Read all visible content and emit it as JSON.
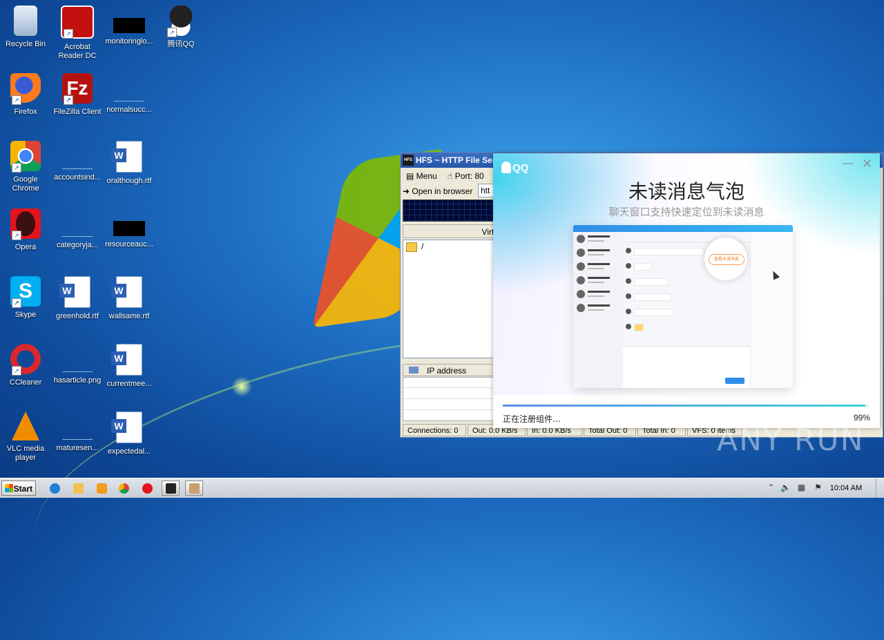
{
  "desktop": {
    "icons": [
      {
        "label": "Recycle Bin",
        "icon": "recycle-bin-icon"
      },
      {
        "label": "Acrobat Reader DC",
        "icon": "acrobat-icon"
      },
      {
        "label": "monitoringlo...",
        "icon": "file-icon"
      },
      {
        "label": "腾讯QQ",
        "icon": "qq-icon"
      },
      {
        "label": "Firefox",
        "icon": "firefox-icon"
      },
      {
        "label": "FileZilla Client",
        "icon": "filezilla-icon"
      },
      {
        "label": "normalsucc...",
        "icon": "file-icon"
      },
      {
        "label": "Google Chrome",
        "icon": "chrome-icon"
      },
      {
        "label": "accountsind...",
        "icon": "file-icon"
      },
      {
        "label": "oralthough.rtf",
        "icon": "word-doc-icon"
      },
      {
        "label": "Opera",
        "icon": "opera-icon"
      },
      {
        "label": "categoryja...",
        "icon": "file-icon"
      },
      {
        "label": "resourceauc...",
        "icon": "file-icon"
      },
      {
        "label": "Skype",
        "icon": "skype-icon"
      },
      {
        "label": "greenhold.rtf",
        "icon": "word-doc-icon"
      },
      {
        "label": "wallsame.rtf",
        "icon": "word-doc-icon"
      },
      {
        "label": "CCleaner",
        "icon": "ccleaner-icon"
      },
      {
        "label": "hasarticle.png",
        "icon": "file-icon"
      },
      {
        "label": "currentmee...",
        "icon": "word-doc-icon"
      },
      {
        "label": "VLC media player",
        "icon": "vlc-icon"
      },
      {
        "label": "maturesen...",
        "icon": "file-icon"
      },
      {
        "label": "expectedal...",
        "icon": "word-doc-icon"
      }
    ]
  },
  "hfs": {
    "title": "HFS ~ HTTP File Serv",
    "menu_label": "Menu",
    "port_label": "Port: 80",
    "open_browser_label": "Open in browser",
    "url_value": "htt",
    "vfs_header": "Virtu",
    "vfs_root": "/",
    "ip_header": "IP address",
    "status": {
      "connections": "Connections: 0",
      "out": "Out: 0.0 KB/s",
      "in": "In: 0.0 KB/s",
      "total_out": "Total Out: 0",
      "total_in": "Total In: 0",
      "vfs_items": "VFS: 0 items"
    }
  },
  "qq_dialog": {
    "logo_text": "QQ",
    "title": "未读消息气泡",
    "subtitle": "聊天窗口支持快速定位到未读消息",
    "preview_bubble": "查看未读消息",
    "status_text": "正在注册组件...",
    "progress_percent": "99%",
    "progress_value": 0.99,
    "colors": {
      "accent": "#2e8de8",
      "bubble": "#f07b1a"
    }
  },
  "watermark": "ANY RUN",
  "taskbar": {
    "start_label": "Start",
    "apps": [
      "ie-icon",
      "explorer-icon",
      "media-player-icon",
      "chrome-icon",
      "opera-icon",
      "hfs-icon",
      "qq-installer-icon"
    ],
    "clock": "10:04 AM"
  }
}
